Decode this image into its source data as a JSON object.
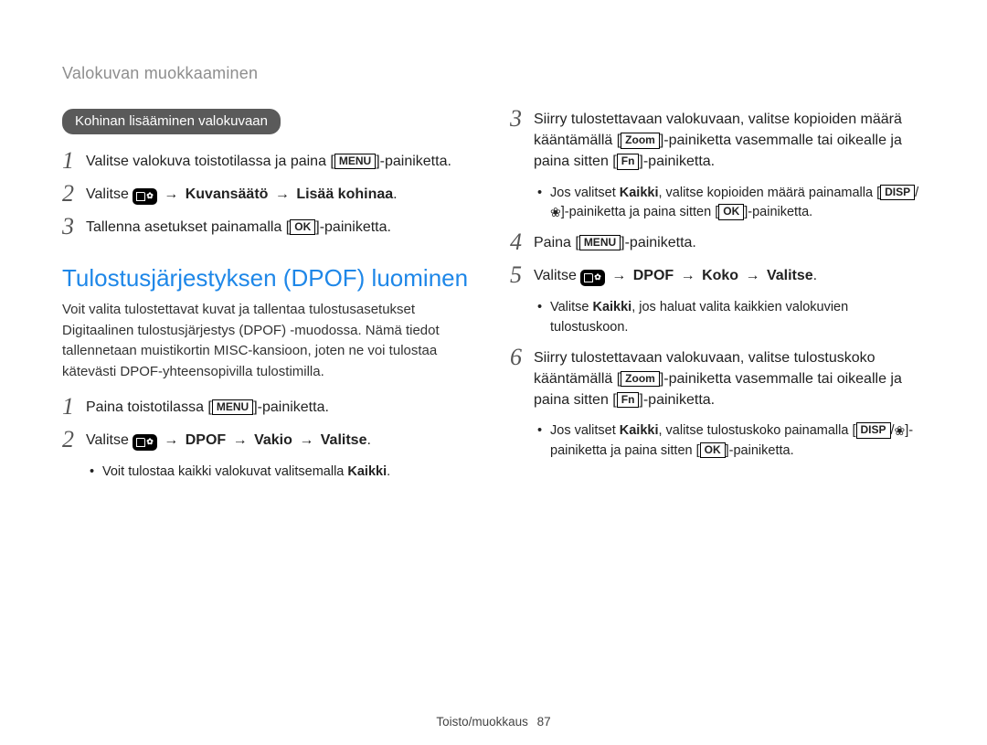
{
  "header": {
    "section_title": "Valokuvan muokkaaminen"
  },
  "left": {
    "pill": "Kohinan lisääminen valokuvaan",
    "steps_a": {
      "s1": {
        "num": "1",
        "pre": "Valitse valokuva toistotilassa ja paina [",
        "menu": "MENU",
        "post": "]-painiketta."
      },
      "s2": {
        "num": "2",
        "pre": "Valitse ",
        "arrow1": " → ",
        "b1": "Kuvansäätö",
        "arrow2": " → ",
        "b2": "Lisää kohinaa",
        "post": "."
      },
      "s3": {
        "num": "3",
        "pre": "Tallenna asetukset painamalla [",
        "ok": "OK",
        "post": "]-painiketta."
      }
    },
    "heading": "Tulostusjärjestyksen (DPOF) luominen",
    "para": "Voit valita tulostettavat kuvat ja tallentaa tulostusasetukset Digitaalinen tulostusjärjestys (DPOF) -muodossa. Nämä tiedot tallennetaan muistikortin MISC-kansioon, joten ne voi tulostaa kätevästi DPOF-yhteensopivilla tulostimilla.",
    "steps_b": {
      "s1": {
        "num": "1",
        "pre": "Paina toistotilassa [",
        "menu": "MENU",
        "post": "]-painiketta."
      },
      "s2": {
        "num": "2",
        "pre": "Valitse ",
        "arrow1": " → ",
        "b1": "DPOF",
        "arrow2": " → ",
        "b2": "Vakio",
        "arrow3": " → ",
        "b3": "Valitse",
        "post": "."
      },
      "bullet1": {
        "dot": "•",
        "pre": "Voit tulostaa kaikki valokuvat valitsemalla ",
        "b": "Kaikki",
        "post": "."
      }
    }
  },
  "right": {
    "s3": {
      "num": "3",
      "l1a": "Siirry tulostettavaan valokuvaan, valitse kopioiden määrä ",
      "l1b": "kääntämällä [",
      "zoom": "Zoom",
      "l1c": "]-painiketta vasemmalle tai oikealle ja ",
      "l1d": "paina sitten [",
      "fn": "Fn",
      "l1e": "]-painiketta."
    },
    "bullet3": {
      "dot": "•",
      "pre": "Jos valitset ",
      "b": "Kaikki",
      "mid": ", valitse kopioiden määrä painamalla ",
      "disp": "DISP",
      "slash": "/",
      "mid2": "]-painiketta ja paina sitten [",
      "ok": "OK",
      "post": "]-painiketta."
    },
    "s4": {
      "num": "4",
      "pre": "Paina [",
      "menu": "MENU",
      "post": "]-painiketta."
    },
    "s5": {
      "num": "5",
      "pre": "Valitse ",
      "arrow1": " → ",
      "b1": "DPOF",
      "arrow2": " → ",
      "b2": "Koko",
      "arrow3": " → ",
      "b3": "Valitse",
      "post": "."
    },
    "bullet5": {
      "dot": "•",
      "pre": "Valitse ",
      "b": "Kaikki",
      "post": ", jos haluat valita kaikkien valokuvien tulostuskoon."
    },
    "s6": {
      "num": "6",
      "l1a": "Siirry tulostettavaan valokuvaan, valitse tulostuskoko ",
      "l1b": "kääntämällä [",
      "zoom": "Zoom",
      "l1c": "]-painiketta vasemmalle tai oikealle ja ",
      "l1d": "paina sitten [",
      "fn": "Fn",
      "l1e": "]-painiketta."
    },
    "bullet6": {
      "dot": "•",
      "pre": "Jos valitset ",
      "b": "Kaikki",
      "mid": ", valitse tulostuskoko painamalla ",
      "disp": "DISP",
      "slash": "/",
      "mid2": "]-painiketta ja paina sitten [",
      "ok": "OK",
      "post": "]-painiketta."
    }
  },
  "footer": {
    "label": "Toisto/muokkaus",
    "page": "87"
  }
}
